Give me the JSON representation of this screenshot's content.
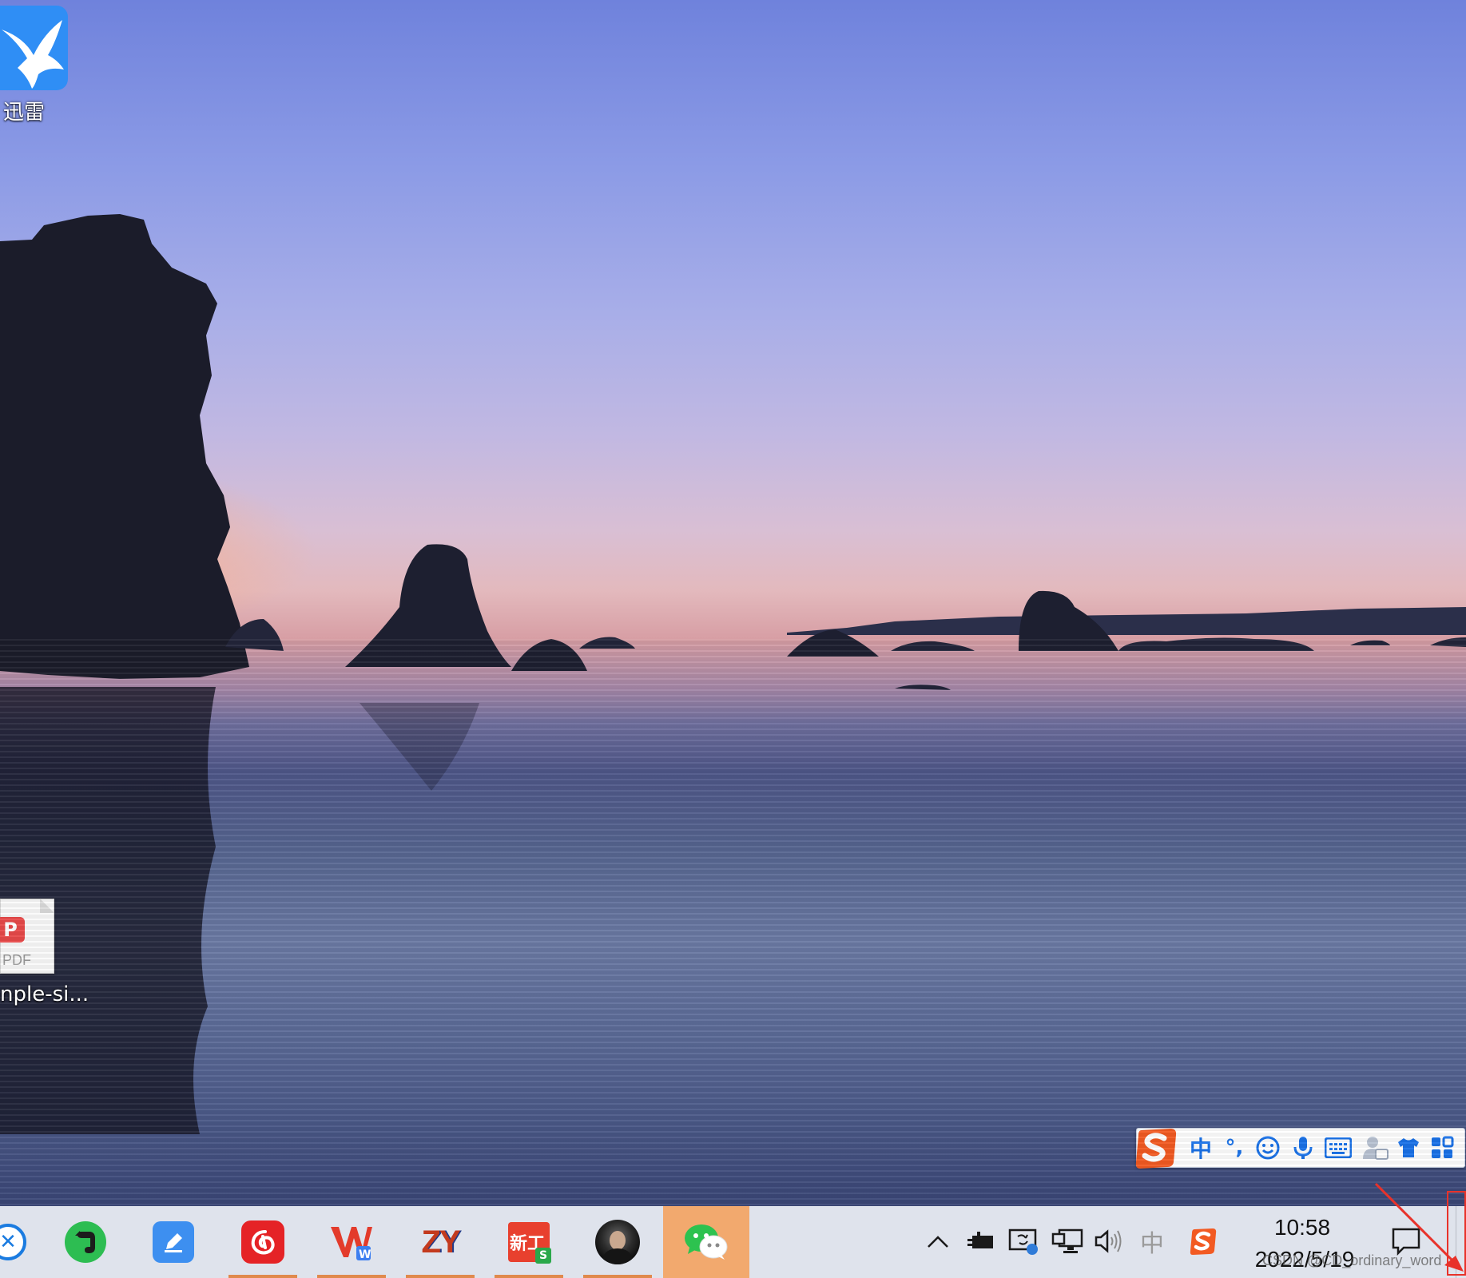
{
  "desktop": {
    "icons": [
      {
        "name": "xunlei",
        "label": "迅雷"
      },
      {
        "name": "pdf-file",
        "label": "nple-si...",
        "badge": "PDF"
      }
    ]
  },
  "ime_toolbar": {
    "mode_label": "中",
    "punct_label": "°,",
    "icons": [
      "sogou-logo-icon",
      "chinese-mode",
      "punctuation-icon",
      "emoji-icon",
      "microphone-icon",
      "keyboard-icon",
      "user-icon",
      "skin-shirt-icon",
      "toolbox-grid-icon"
    ]
  },
  "taskbar": {
    "apps": [
      {
        "name": "partial-app-icon",
        "running": false
      },
      {
        "name": "evernote-icon",
        "running": false
      },
      {
        "name": "pen-app-icon",
        "running": false
      },
      {
        "name": "netease-music-icon",
        "running": true
      },
      {
        "name": "wps-writer-icon",
        "running": true
      },
      {
        "name": "zy-app-icon",
        "running": true,
        "label": "ZY"
      },
      {
        "name": "xin-s-app-icon",
        "running": true,
        "label": "新工"
      },
      {
        "name": "avatar-app-icon",
        "running": true
      },
      {
        "name": "wechat-icon",
        "running": true,
        "active": true
      }
    ],
    "tray": {
      "icons": [
        "show-hidden-chevron-icon",
        "power-plug-icon",
        "display-sync-icon",
        "network-monitor-icon",
        "volume-icon",
        "ime-zhong-icon",
        "sogou-tray-icon"
      ],
      "ime_tray_label": "中"
    },
    "clock": {
      "time": "10:58",
      "date": "2022/5/19"
    },
    "watermark": "CSDN @CD_ordinary_word"
  },
  "colors": {
    "taskbar_bg": "#dfe3ec",
    "active_app_bg": "#f2a96e",
    "ime_blue": "#1a72e8",
    "sogou_orange": "#f25a22",
    "annotation_red": "#e8322a"
  }
}
